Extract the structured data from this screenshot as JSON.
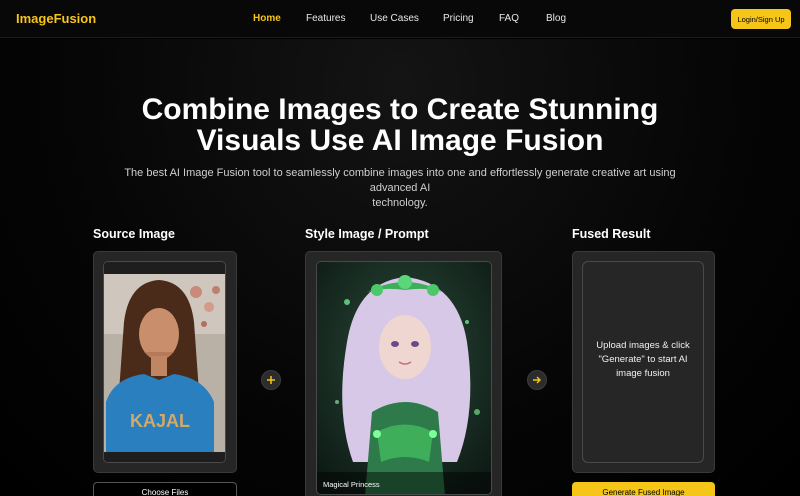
{
  "nav": {
    "logo": "ImageFusion",
    "links": [
      "Home",
      "Features",
      "Use Cases",
      "Pricing",
      "FAQ",
      "Blog"
    ],
    "active": "Home",
    "login_label": "Login/Sign Up"
  },
  "hero": {
    "title_line1": "Combine Images to Create Stunning",
    "title_line2": "Visuals Use AI Image Fusion",
    "subtitle_line1": "The best AI Image Fusion tool to seamlessly combine images into one and effortlessly generate creative art using advanced AI",
    "subtitle_line2": "technology."
  },
  "source": {
    "title": "Source Image",
    "shirt_text": "KAJAL",
    "choose_label": "Choose Files"
  },
  "style": {
    "title": "Style Image / Prompt",
    "caption": "Magical Princess"
  },
  "result": {
    "title": "Fused Result",
    "placeholder_line1": "Upload images & click",
    "placeholder_line2": "\"Generate\" to start AI",
    "placeholder_line3": "image fusion",
    "generate_label": "Generate Fused Image"
  },
  "icons": {
    "plus": "plus-icon",
    "arrow": "arrow-right-icon"
  },
  "colors": {
    "accent": "#f5c518",
    "background": "#000000",
    "card": "#262626"
  }
}
